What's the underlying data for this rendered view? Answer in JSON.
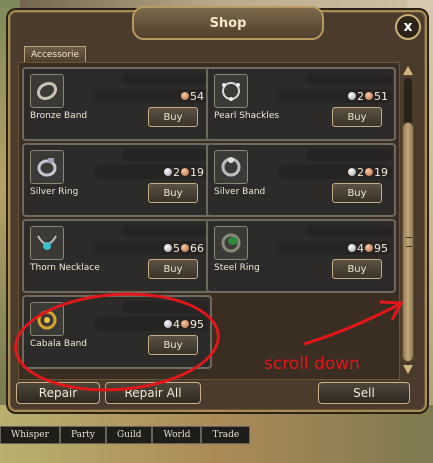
{
  "window": {
    "title": "Shop",
    "close_label": "x"
  },
  "tabs": [
    {
      "label": "Accessorie"
    }
  ],
  "items": [
    {
      "name": "Bronze Band",
      "price": {
        "silver": null,
        "copper": "54"
      },
      "buy_label": "Buy",
      "icon": "bronze-band-icon"
    },
    {
      "name": "Pearl Shackles",
      "price": {
        "silver": "2",
        "copper": "51"
      },
      "buy_label": "Buy",
      "icon": "pearl-shackles-icon"
    },
    {
      "name": "Silver Ring",
      "price": {
        "silver": "2",
        "copper": "19"
      },
      "buy_label": "Buy",
      "icon": "silver-ring-icon"
    },
    {
      "name": "Silver Band",
      "price": {
        "silver": "2",
        "copper": "19"
      },
      "buy_label": "Buy",
      "icon": "silver-band-icon"
    },
    {
      "name": "Thorn Necklace",
      "price": {
        "silver": "5",
        "copper": "66"
      },
      "buy_label": "Buy",
      "icon": "thorn-necklace-icon"
    },
    {
      "name": "Steel Ring",
      "price": {
        "silver": "4",
        "copper": "95"
      },
      "buy_label": "Buy",
      "icon": "steel-ring-icon"
    },
    {
      "name": "Cabala Band",
      "price": {
        "silver": "4",
        "copper": "95"
      },
      "buy_label": "Buy",
      "icon": "cabala-band-icon"
    }
  ],
  "buttons": {
    "repair": "Repair",
    "repair_all": "Repair All",
    "sell": "Sell"
  },
  "chat_tabs": [
    "Whisper",
    "Party",
    "Guild",
    "World",
    "Trade"
  ],
  "annotation": {
    "text": "scroll down",
    "color": "#e3161a"
  }
}
